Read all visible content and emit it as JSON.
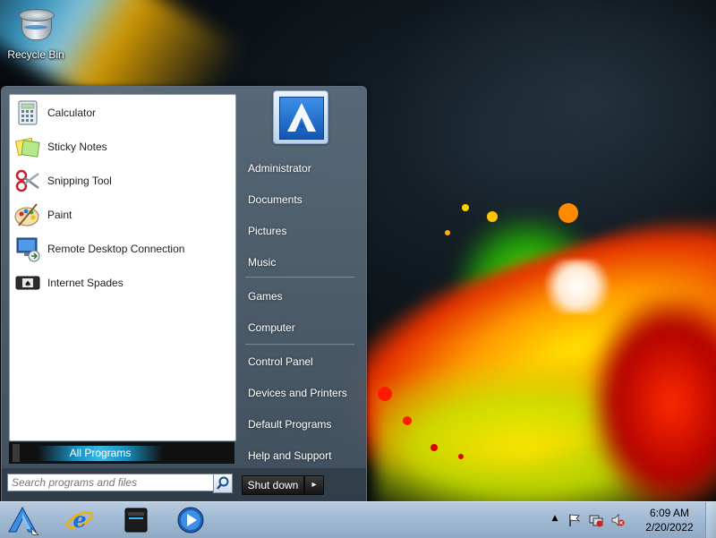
{
  "desktop": {
    "icons": [
      {
        "label": "Recycle Bin",
        "icon": "recycle-bin-icon"
      }
    ]
  },
  "start_menu": {
    "programs": [
      {
        "label": "Calculator",
        "icon": "calculator-icon"
      },
      {
        "label": "Sticky Notes",
        "icon": "sticky-notes-icon"
      },
      {
        "label": "Snipping Tool",
        "icon": "snipping-tool-icon"
      },
      {
        "label": "Paint",
        "icon": "paint-icon"
      },
      {
        "label": "Remote Desktop Connection",
        "icon": "remote-desktop-icon"
      },
      {
        "label": "Internet Spades",
        "icon": "internet-spades-icon"
      }
    ],
    "all_programs": "All Programs",
    "search_placeholder": "Search programs and files",
    "user_picture_icon": "assassins-creed-logo-icon",
    "right_items": [
      "Administrator",
      "Documents",
      "Pictures",
      "Music",
      "Games",
      "Computer",
      "Control Panel",
      "Devices and Printers",
      "Default Programs",
      "Help and Support"
    ],
    "shutdown_label": "Shut down",
    "shutdown_arrow": "▸"
  },
  "taskbar": {
    "start_icon": "start-orb-icon",
    "pinned": [
      {
        "name": "internet-explorer",
        "icon": "internet-explorer-icon"
      },
      {
        "name": "file-explorer",
        "icon": "file-explorer-icon"
      },
      {
        "name": "media-player",
        "icon": "media-player-icon"
      }
    ],
    "tray": {
      "show_hidden": "▲",
      "icons": [
        "action-center-flag-icon",
        "network-icon",
        "volume-muted-icon"
      ]
    },
    "clock": {
      "time": "6:09 AM",
      "date": "2/20/2022"
    }
  },
  "colors": {
    "taskbar": "#a2bad3",
    "start_menu_glass": "#5a6c7c",
    "all_programs_highlight": "#3ab7e6"
  }
}
